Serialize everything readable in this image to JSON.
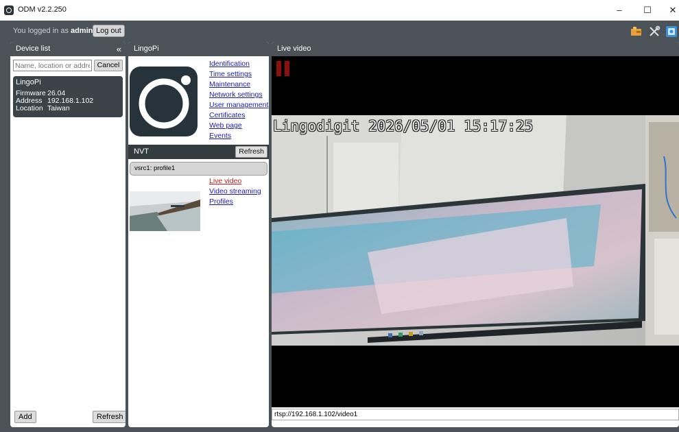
{
  "window": {
    "title": "ODM v2.2.250",
    "minimize": "–",
    "maximize": "☐",
    "close": "✕"
  },
  "login": {
    "prefix": "You logged in as",
    "user": "admin",
    "logout_label": "Log out"
  },
  "toolbar_icons": [
    "puzzle-icon",
    "tools-icon",
    "help-icon"
  ],
  "device_list": {
    "title": "Device list",
    "collapse": "«",
    "search_placeholder": "Name, location or address",
    "cancel_label": "Cancel",
    "devices": [
      {
        "name": "LingoPi",
        "firmware_label": "Firmware",
        "firmware": "26.04",
        "address_label": "Address",
        "address": "192.168.1.102",
        "location_label": "Location",
        "location": "Taiwan"
      }
    ],
    "add_label": "Add",
    "refresh_label": "Refresh"
  },
  "device_panel": {
    "title": "LingoPi",
    "links": [
      "Identification",
      "Time settings",
      "Maintenance",
      "Network settings",
      "User management",
      "Certificates",
      "Web page",
      "Events"
    ],
    "nvt": {
      "title": "NVT",
      "refresh_label": "Refresh",
      "profile_tab": "vsrc1: profile1",
      "profile_links": [
        "Live video",
        "Video streaming",
        "Profiles"
      ],
      "active_link": "Live video"
    }
  },
  "live_video": {
    "title": "Live video",
    "osd": "Lingodigit 2026/05/01 15:17:25",
    "url": "rtsp://192.168.1.102/video1",
    "pause_color": "#8c1010"
  },
  "colors": {
    "chrome": "#4b5358",
    "card": "#3b4348",
    "link": "#1b1bb0",
    "active_link": "#cc1a1a"
  }
}
